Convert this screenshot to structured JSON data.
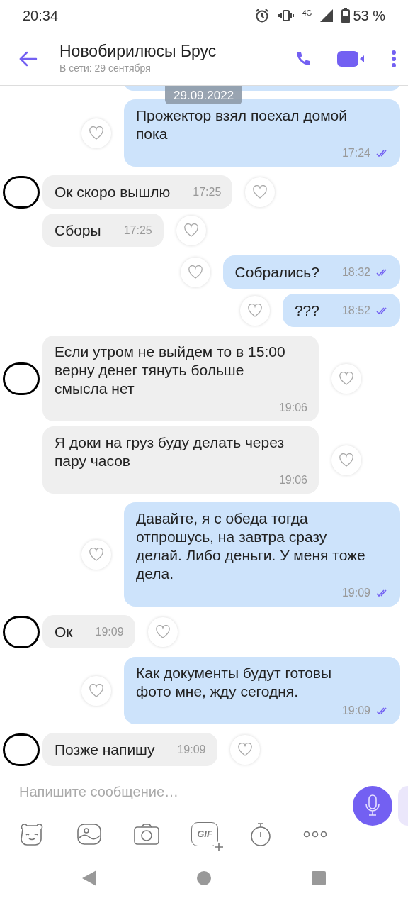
{
  "status_bar": {
    "time": "20:34",
    "network": "4G",
    "battery": "53 %"
  },
  "header": {
    "title": "Новобирилюсы Брус",
    "subtitle": "В сети: 29 сентября"
  },
  "date_badge": "29.09.2022",
  "messages": [
    {
      "outgoing": true,
      "kind": "stacked",
      "text": "Прожектор взял поехал домой пока",
      "time": "17:24",
      "read": true
    },
    {
      "outgoing": false,
      "kind": "inline",
      "text": "Ок скоро вышлю",
      "time": "17:25",
      "avatar": true
    },
    {
      "outgoing": false,
      "kind": "inline",
      "text": "Сборы",
      "time": "17:25",
      "avatar": false
    },
    {
      "outgoing": true,
      "kind": "inline",
      "text": "Собрались?",
      "time": "18:32",
      "read": true
    },
    {
      "outgoing": true,
      "kind": "inline",
      "text": "???",
      "time": "18:52",
      "read": true
    },
    {
      "outgoing": false,
      "kind": "stacked",
      "text": "Если утром не выйдем то в 15:00 верну денег тянуть больше смысла нет",
      "time": "19:06",
      "avatar": true
    },
    {
      "outgoing": false,
      "kind": "stacked",
      "text": "Я доки на груз буду делать через пару часов",
      "time": "19:06",
      "avatar": false
    },
    {
      "outgoing": true,
      "kind": "stacked",
      "text": "Давайте, я с обеда тогда отпрошусь, на завтра сразу делай. Либо деньги. У меня тоже дела.",
      "time": "19:09",
      "read": true
    },
    {
      "outgoing": false,
      "kind": "inline",
      "text": "Ок",
      "time": "19:09",
      "avatar": true
    },
    {
      "outgoing": true,
      "kind": "stacked",
      "text": "Как документы будут готовы фото мне, жду сегодня.",
      "time": "19:09",
      "read": true
    },
    {
      "outgoing": false,
      "kind": "inline",
      "text": "Позже напишу",
      "time": "19:09",
      "avatar": true
    }
  ],
  "composer": {
    "placeholder": "Напишите сообщение…",
    "gif_label": "GIF"
  }
}
